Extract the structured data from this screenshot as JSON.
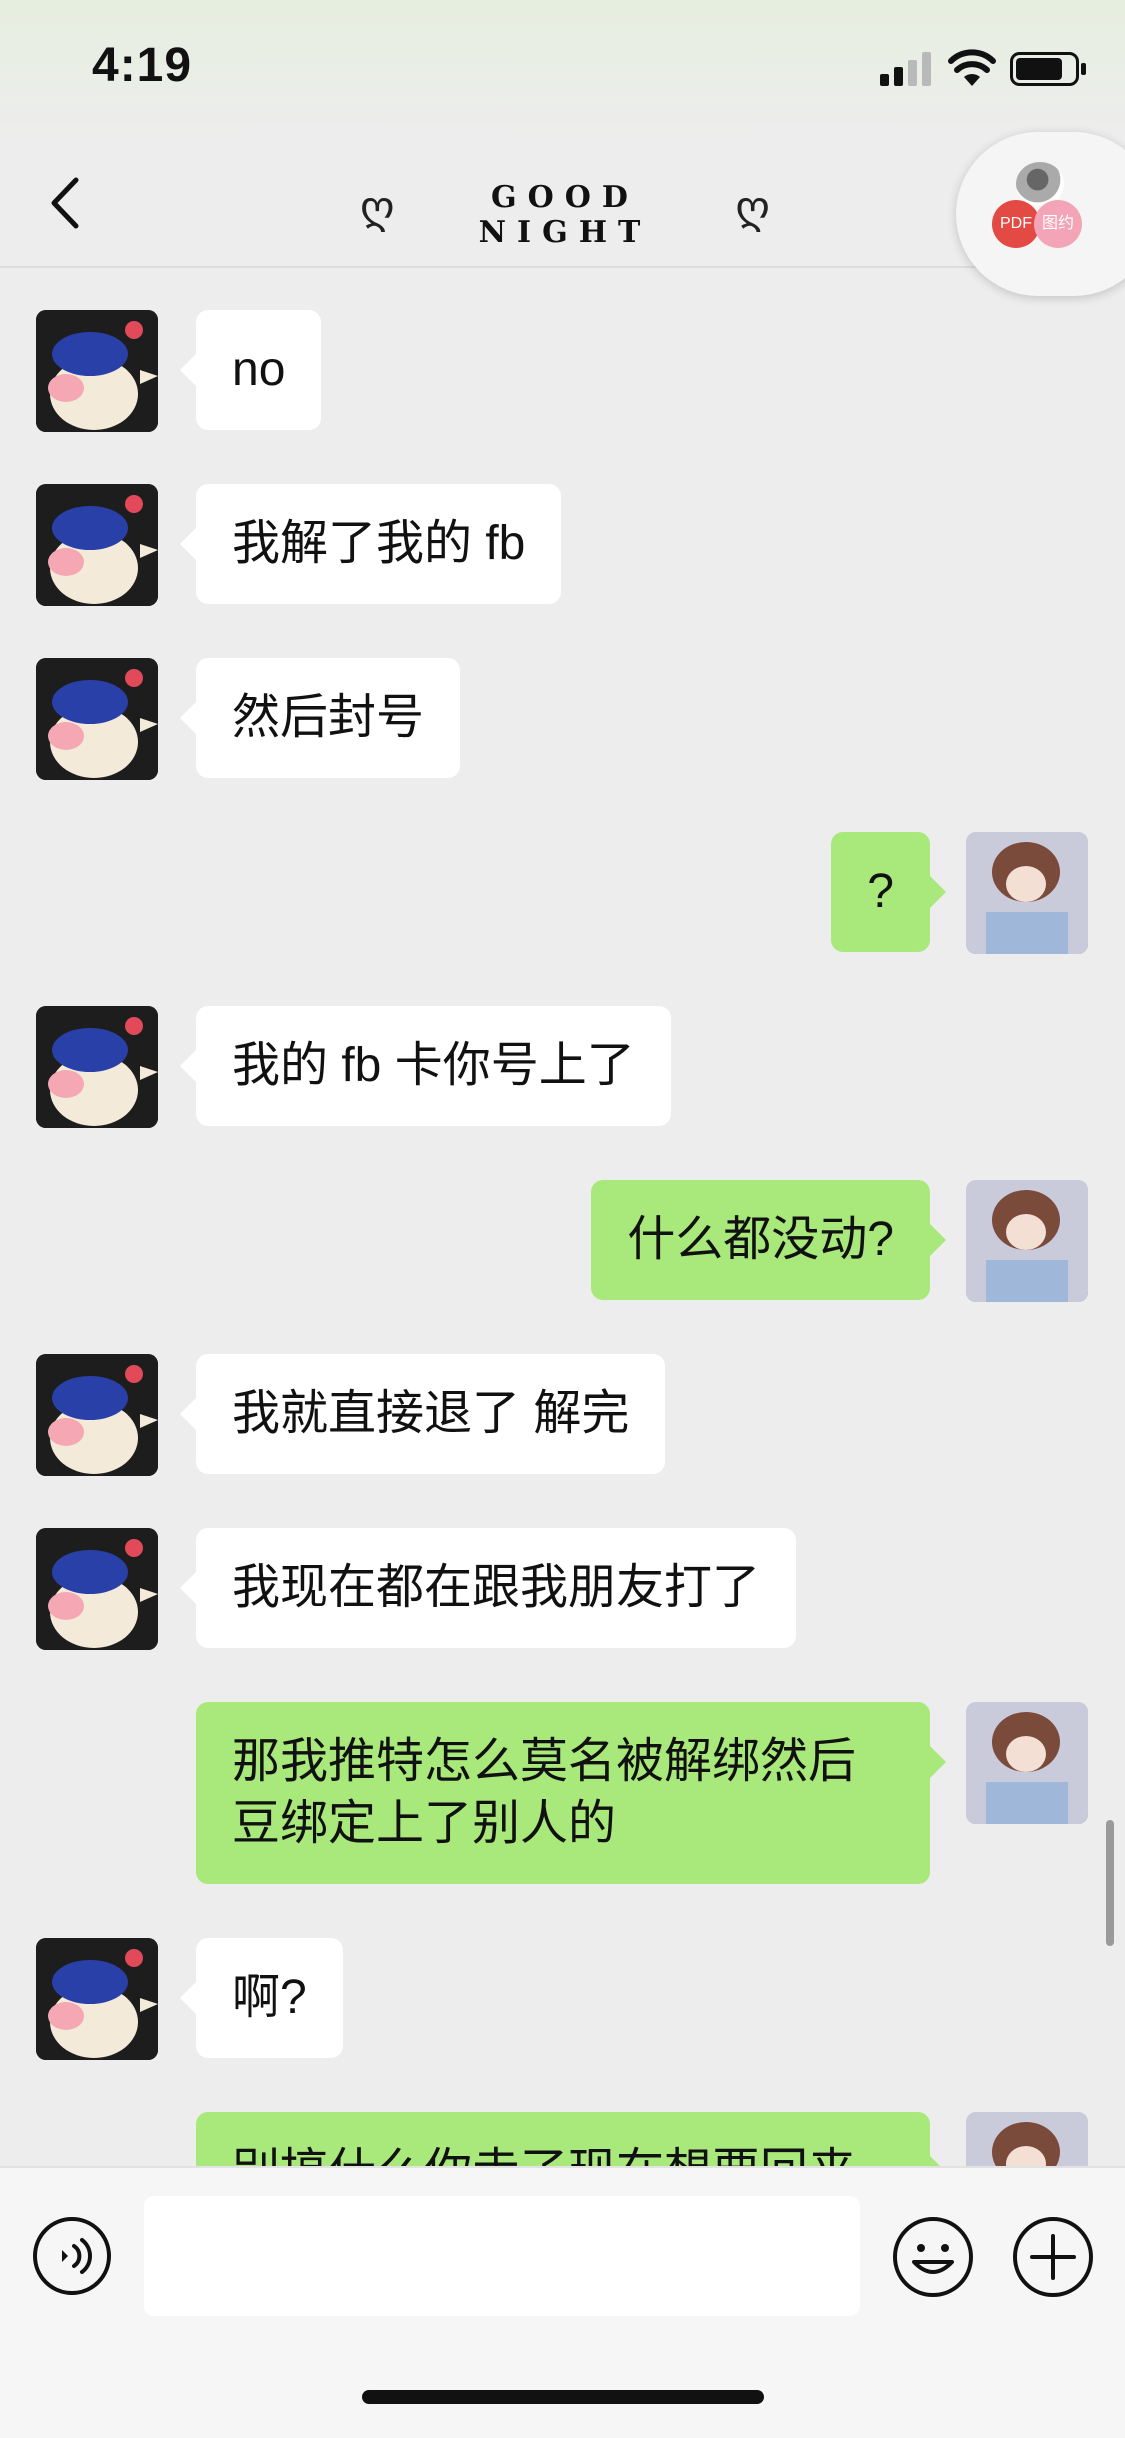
{
  "status_bar": {
    "time": "4:19",
    "icons": [
      "signal-icon",
      "wifi-icon",
      "battery-icon"
    ]
  },
  "header": {
    "title": "GOOD NIGHT",
    "title_decoration": "ღ",
    "back_icon": "chevron-left-icon",
    "floating_badges": [
      "PDF",
      "图约"
    ]
  },
  "colors": {
    "sent_bubble": "#a9e87a",
    "received_bubble": "#ffffff",
    "background": "#ededed"
  },
  "messages": [
    {
      "side": "left",
      "text": "no"
    },
    {
      "side": "left",
      "text": "我解了我的 fb"
    },
    {
      "side": "left",
      "text": "然后封号"
    },
    {
      "side": "right",
      "text": "?"
    },
    {
      "side": "left",
      "text": "我的 fb 卡你号上了"
    },
    {
      "side": "right",
      "text": "什么都没动?"
    },
    {
      "side": "left",
      "text": "我就直接退了 解完"
    },
    {
      "side": "left",
      "text": "我现在都在跟我朋友打了"
    },
    {
      "side": "right",
      "text": "那我推特怎么莫名被解绑然后豆绑定上了别人的"
    },
    {
      "side": "left",
      "text": "啊?"
    },
    {
      "side": "right",
      "text": "别搞什么你走了现在想要回来"
    }
  ],
  "input_bar": {
    "placeholder": "",
    "icons": [
      "voice-icon",
      "emoji-icon",
      "plus-icon"
    ]
  }
}
